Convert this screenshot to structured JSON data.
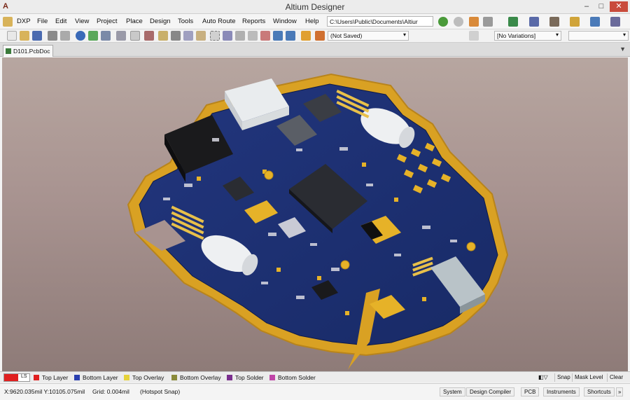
{
  "app": {
    "title": "Altium Designer",
    "logo_letter": "A"
  },
  "menu": {
    "items": [
      "DXP",
      "File",
      "Edit",
      "View",
      "Project",
      "Place",
      "Design",
      "Tools",
      "Auto Route",
      "Reports",
      "Window",
      "Help"
    ],
    "path": "C:\\Users\\Public\\Documents\\Altiur"
  },
  "toolbar2": {
    "saved_state": "(Not Saved)",
    "variations": "[No Variations]"
  },
  "document": {
    "tab_label": "D101.PcbDoc"
  },
  "layers": {
    "current_short": "LS",
    "tabs": [
      {
        "label": "Top Layer",
        "color": "#e02020"
      },
      {
        "label": "Bottom Layer",
        "color": "#2a3fb0"
      },
      {
        "label": "Top Overlay",
        "color": "#e6d23a"
      },
      {
        "label": "Bottom Overlay",
        "color": "#8a8a3a"
      },
      {
        "label": "Top Solder",
        "color": "#7b2f8f"
      },
      {
        "label": "Bottom Solder",
        "color": "#c045a8"
      }
    ],
    "right_buttons": [
      "Snap",
      "Mask Level",
      "Clear"
    ]
  },
  "status": {
    "coords": "X:9620.035mil Y:10105.075mil",
    "grid": "Grid: 0.004mil",
    "snap": "(Hotspot Snap)",
    "panels": [
      "System",
      "Design Compiler",
      "PCB",
      "Instruments",
      "Shortcuts"
    ]
  },
  "colors": {
    "board": "#1b2c6e",
    "outline": "#d9a123",
    "accent_menu": "#c94b3c"
  }
}
